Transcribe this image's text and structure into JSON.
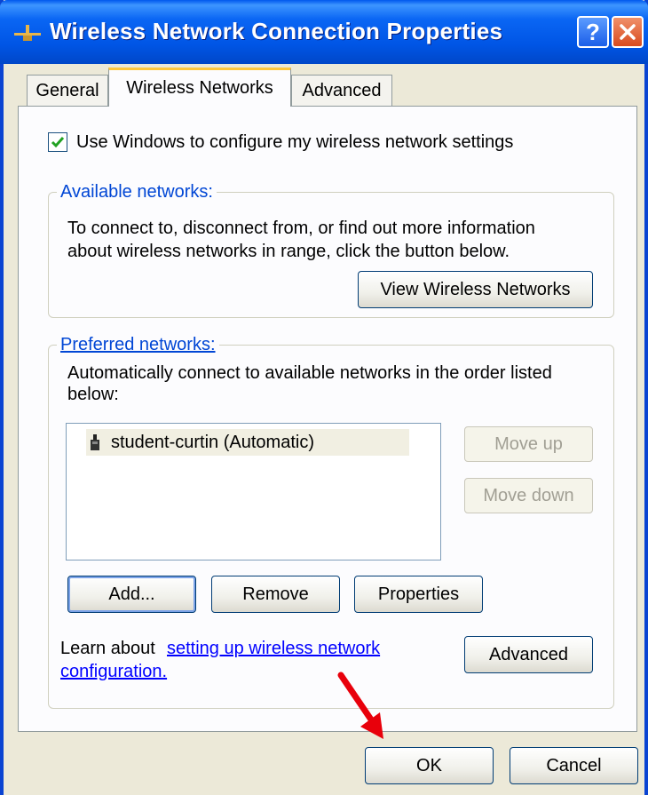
{
  "window": {
    "title": "Wireless Network Connection Properties"
  },
  "tabs": [
    {
      "label": "General",
      "active": false
    },
    {
      "label": "Wireless Networks",
      "active": true
    },
    {
      "label": "Advanced",
      "active": false
    }
  ],
  "use_windows_checkbox": {
    "label": "Use Windows to configure my wireless network settings",
    "checked": true
  },
  "available_networks": {
    "legend": "Available networks:",
    "line1": "To connect to, disconnect from, or find out more information",
    "line2": "about wireless networks in range, click the button below.",
    "button": "View Wireless Networks"
  },
  "preferred_networks": {
    "legend": "Preferred networks:",
    "line1": "Automatically connect to available networks in the order listed",
    "line2": "below:",
    "items": [
      {
        "label": "student-curtin (Automatic)",
        "icon": "wireless-antenna-icon"
      }
    ],
    "move_up": "Move up",
    "move_down": "Move down",
    "add": "Add...",
    "remove": "Remove",
    "properties": "Properties"
  },
  "learn_about": {
    "prefix": "Learn about ",
    "link_line1": "setting up wireless network",
    "link_line2": "configuration."
  },
  "advanced_button": "Advanced",
  "ok_button": "OK",
  "cancel_button": "Cancel",
  "colors": {
    "titlebar": "#0055E5",
    "dialog_bg": "#ECE9D8",
    "legend": "#0046D5",
    "arrow": "#E8000B",
    "tab_highlight": "#FFC83C"
  },
  "annotation": {
    "type": "red-arrow",
    "points_to": "ok-button"
  }
}
